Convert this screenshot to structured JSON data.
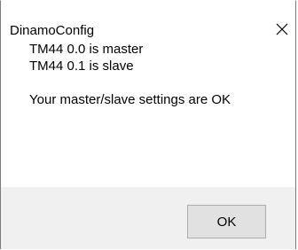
{
  "window": {
    "title": "DinamoConfig",
    "close_icon": "close-icon"
  },
  "message": {
    "lines": [
      "TM44  0.0 is master",
      "TM44  0.1 is slave",
      "Your master/slave settings are OK"
    ]
  },
  "footer": {
    "ok_label": "OK"
  },
  "colors": {
    "content_background": "#ffffff",
    "footer_background": "#f0f0f0",
    "button_face": "#e1e1e1",
    "button_border": "#adadad",
    "window_border": "#7a7a7a"
  }
}
